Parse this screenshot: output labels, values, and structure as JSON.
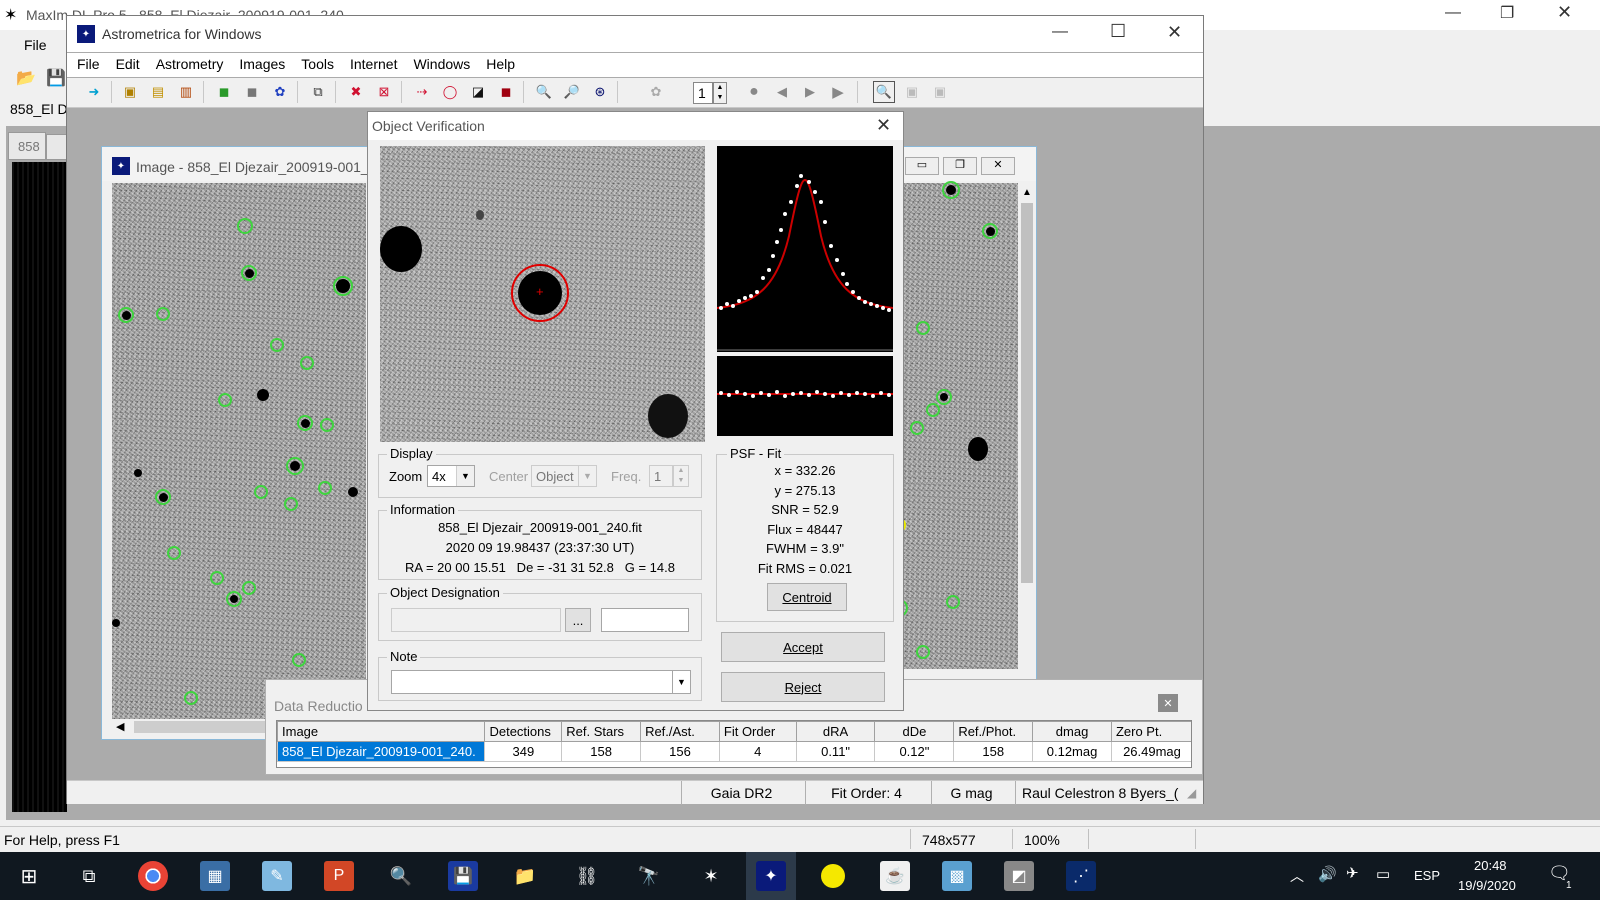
{
  "maxim": {
    "title": "MaxIm DL Pro 5 - 858_El Djezair_200919-001_240",
    "menu_file": "File",
    "tab_label": "858_El D",
    "doc_tab": "858",
    "status_help": "For Help, press F1",
    "status_dims": "748x577",
    "status_zoom": "100%"
  },
  "astrometrica": {
    "title": "Astrometrica for Windows",
    "menu": [
      "File",
      "Edit",
      "Astrometry",
      "Images",
      "Tools",
      "Internet",
      "Windows",
      "Help"
    ],
    "frame_number": "1",
    "status": [
      "Gaia DR2",
      "Fit Order: 4",
      "G mag",
      "Raul Celestron 8 Byers_("
    ]
  },
  "image_window": {
    "title": "Image - 858_El Djezair_200919-001_"
  },
  "object_verification": {
    "title": "Object Verification",
    "display": {
      "label": "Display",
      "zoom_label": "Zoom",
      "zoom_value": "4x",
      "center_label": "Center",
      "center_value": "Object",
      "freq_label": "Freq.",
      "freq_value": "1"
    },
    "information": {
      "label": "Information",
      "filename": "858_El Djezair_200919-001_240.fit",
      "date": "2020 09 19.98437 (23:37:30 UT)",
      "coords": "RA = 20 00 15.51   De = -31 31 52.8   G = 14.8"
    },
    "designation": {
      "label": "Object Designation",
      "browse_label": "...",
      "value": ""
    },
    "note": {
      "label": "Note",
      "value": ""
    },
    "psf": {
      "label": "PSF - Fit",
      "x": "x = 332.26",
      "y": "y = 275.13",
      "snr": "SNR = 52.9",
      "flux": "Flux = 48447",
      "fwhm": "FWHM = 3.9\"",
      "fit_rms": "Fit RMS = 0.021",
      "centroid_label": "Centroid"
    },
    "accept_label": "Accept",
    "reject_label": "Reject"
  },
  "data_reduction": {
    "title": "Data Reductio",
    "columns": [
      "Image",
      "Detections",
      "Ref. Stars",
      "Ref./Ast.",
      "Fit Order",
      "dRA",
      "dDe",
      "Ref./Phot.",
      "dmag",
      "Zero Pt."
    ],
    "rows": [
      [
        "858_El Djezair_200919-001_240.",
        "349",
        "158",
        "156",
        "4",
        "0.11\"",
        "0.12\"",
        "158",
        "0.12mag",
        "26.49mag"
      ]
    ]
  },
  "taskbar": {
    "language": "ESP",
    "time": "20:48",
    "date": "19/9/2020",
    "notification_count": "1"
  },
  "colors": {
    "selection": "#0078d7",
    "ring": "#3fd43f",
    "psf_curve": "#cc0000",
    "taskbar": "#101820"
  }
}
